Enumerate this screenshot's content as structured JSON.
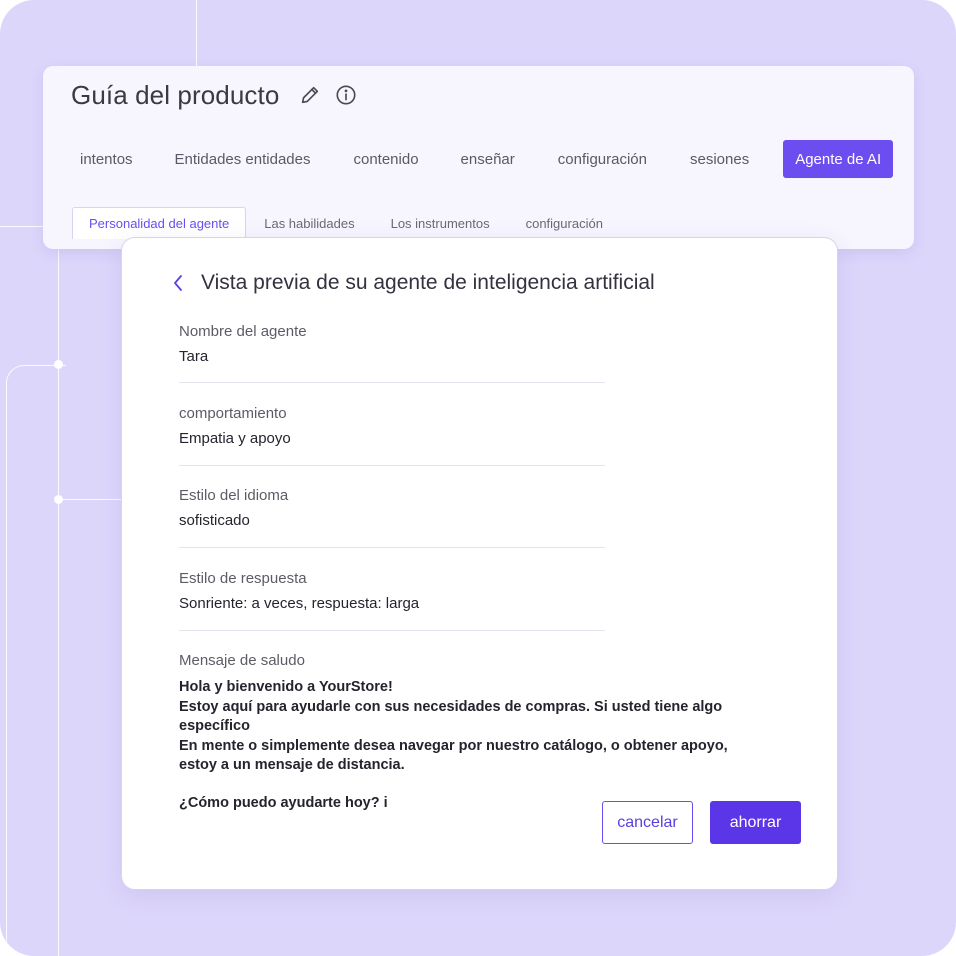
{
  "header": {
    "title": "Guía del producto",
    "edit_icon": "pencil-icon",
    "info_icon": "info-icon"
  },
  "main_tabs": [
    {
      "label": "intentos",
      "active": false
    },
    {
      "label": "Entidades entidades",
      "active": false
    },
    {
      "label": "contenido",
      "active": false
    },
    {
      "label": "enseñar",
      "active": false
    },
    {
      "label": "configuración",
      "active": false
    },
    {
      "label": "sesiones",
      "active": false
    },
    {
      "label": "Agente de AI",
      "active": true
    }
  ],
  "sub_tabs": [
    {
      "label": "Personalidad del agente",
      "active": true
    },
    {
      "label": "Las habilidades",
      "active": false
    },
    {
      "label": "Los instrumentos",
      "active": false
    },
    {
      "label": "configuración",
      "active": false
    }
  ],
  "preview": {
    "back_icon": "chevron-left-icon",
    "title": "Vista previa de su agente de inteligencia artificial",
    "fields": [
      {
        "label": "Nombre del agente",
        "value": "Tara"
      },
      {
        "label": "comportamiento",
        "value": "Empatia y apoyo"
      },
      {
        "label": "Estilo del idioma",
        "value": "sofisticado"
      },
      {
        "label": "Estilo de respuesta",
        "value": "Sonriente: a veces, respuesta: larga"
      }
    ],
    "greeting": {
      "label": "Mensaje de saludo",
      "lines": [
        "Hola y bienvenido a YourStore!",
        "Estoy aquí para ayudarle con sus necesidades de compras. Si usted tiene algo específico",
        "En mente o simplemente desea navegar por nuestro catálogo, o obtener apoyo, estoy a un mensaje de distancia."
      ],
      "question": "¿Cómo puedo ayudarte hoy? i"
    },
    "cancel_label": "cancelar",
    "save_label": "ahorrar"
  },
  "colors": {
    "background": "#ddd6fb",
    "accent": "#6c4df0",
    "primary_button": "#5b35e8"
  }
}
